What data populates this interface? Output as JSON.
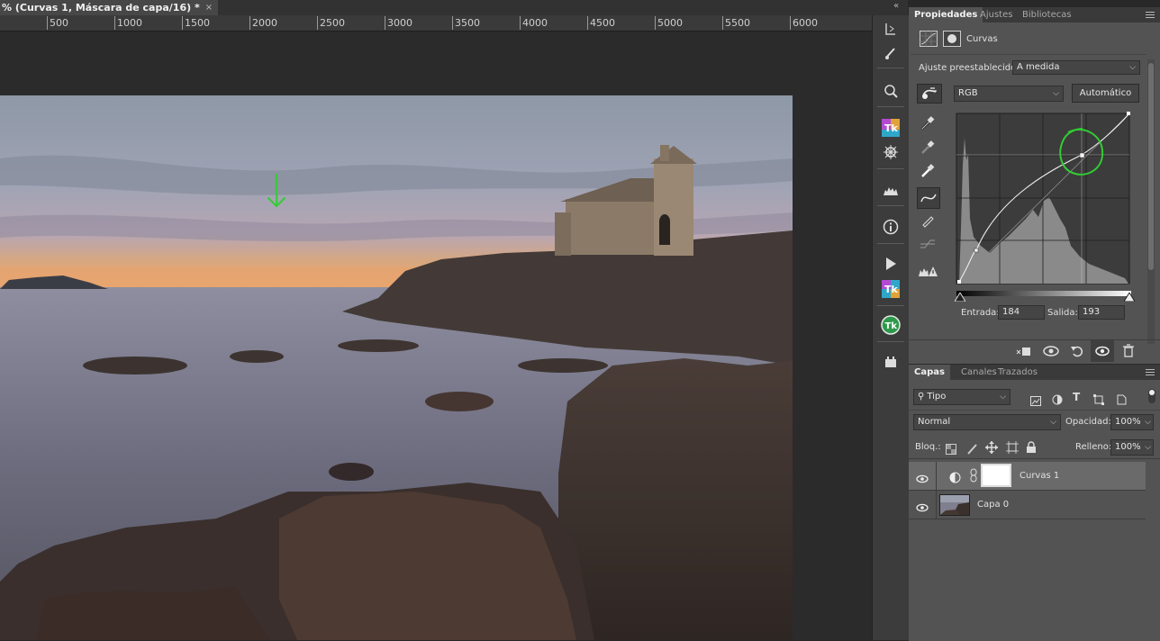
{
  "document": {
    "tab_title": "% (Curvas 1, Máscara de capa/16) *",
    "close_glyph": "×",
    "ruler_marks": [
      "500",
      "1000",
      "1500",
      "2000",
      "2500",
      "3000",
      "3500",
      "4000",
      "4500",
      "5000",
      "5500",
      "6000"
    ]
  },
  "properties_panel": {
    "tabs": [
      "Propiedades",
      "Ajustes",
      "Bibliotecas"
    ],
    "header_label": "Curvas",
    "preset_label": "Ajuste preestablecido:",
    "preset_value": "A medida",
    "channel_value": "RGB",
    "auto_button": "Automático",
    "input_label": "Entrada:",
    "input_value": "184",
    "output_label": "Salida:",
    "output_value": "193"
  },
  "layers_panel": {
    "tabs": [
      "Capas",
      "Canales",
      "Trazados"
    ],
    "filter_value": "Tipo",
    "blend_mode": "Normal",
    "opacity_label": "Opacidad:",
    "opacity_value": "100%",
    "lock_label": "Bloq.:",
    "fill_label": "Relleno:",
    "fill_value": "100%",
    "layers": [
      {
        "name": "Curvas 1",
        "selected": true
      },
      {
        "name": "Capa 0",
        "selected": false
      }
    ]
  },
  "annotation": {
    "color": "#33cc33"
  }
}
